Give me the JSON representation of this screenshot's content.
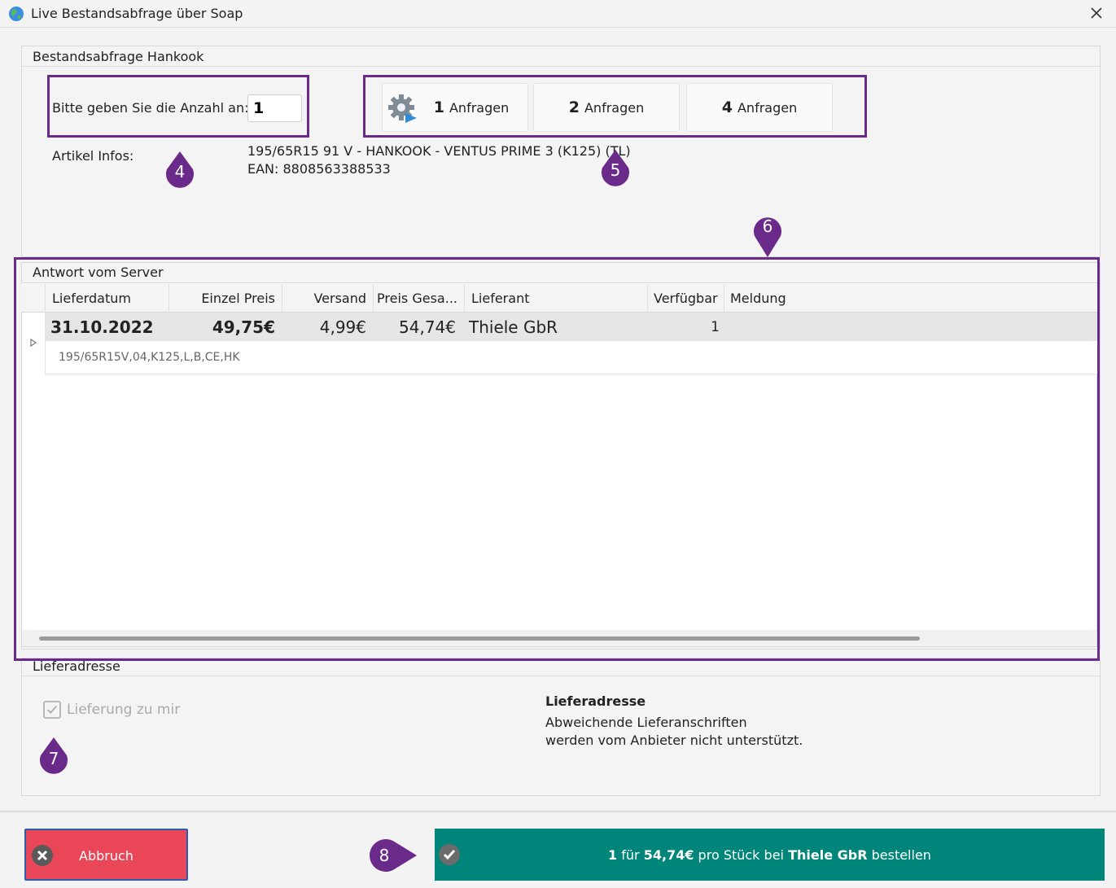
{
  "window": {
    "title": "Live Bestandsabfrage über Soap"
  },
  "query": {
    "header": "Bestandsabfrage Hankook",
    "anzahl_label": "Bitte geben Sie die Anzahl an:",
    "anzahl_value": "1",
    "buttons": [
      {
        "num": "1",
        "label": "Anfragen"
      },
      {
        "num": "2",
        "label": "Anfragen"
      },
      {
        "num": "4",
        "label": "Anfragen"
      }
    ],
    "artikel_label": "Artikel Infos:",
    "artikel_line1": "195/65R15 91 V - HANKOOK - VENTUS PRIME 3 (K125) (TL)",
    "artikel_line2": "EAN: 8808563388533"
  },
  "server": {
    "header": "Antwort vom Server",
    "columns": [
      "Lieferdatum",
      "Einzel Preis",
      "Versand",
      "Preis Gesa...",
      "Lieferant",
      "Verfügbar",
      "Meldung"
    ],
    "row": {
      "lieferdatum": "31.10.2022",
      "einzelpreis": "49,75€",
      "versand": "4,99€",
      "gesamt": "54,74€",
      "lieferant": "Thiele GbR",
      "verfuegbar": "1",
      "meldung": "",
      "detail": "195/65R15V,04,K125,L,B,CE,HK"
    }
  },
  "address": {
    "header": "Lieferadresse",
    "checkbox_label": "Lieferung zu mir",
    "title": "Lieferadresse",
    "line1": "Abweichende Lieferanschriften",
    "line2": "werden vom Anbieter nicht unterstützt."
  },
  "actions": {
    "cancel_label": "Abbruch",
    "order_qty": "1",
    "order_mid1": " für ",
    "order_price": "54,74€",
    "order_mid2": " pro Stück bei ",
    "order_supplier": "Thiele GbR",
    "order_end": " bestellen"
  },
  "markers": [
    "4",
    "5",
    "6",
    "7",
    "8"
  ],
  "colors": {
    "highlight": "#6a2a8a",
    "marker": "#6a2a8a",
    "cancel": "#e94757",
    "order": "#00857a"
  }
}
